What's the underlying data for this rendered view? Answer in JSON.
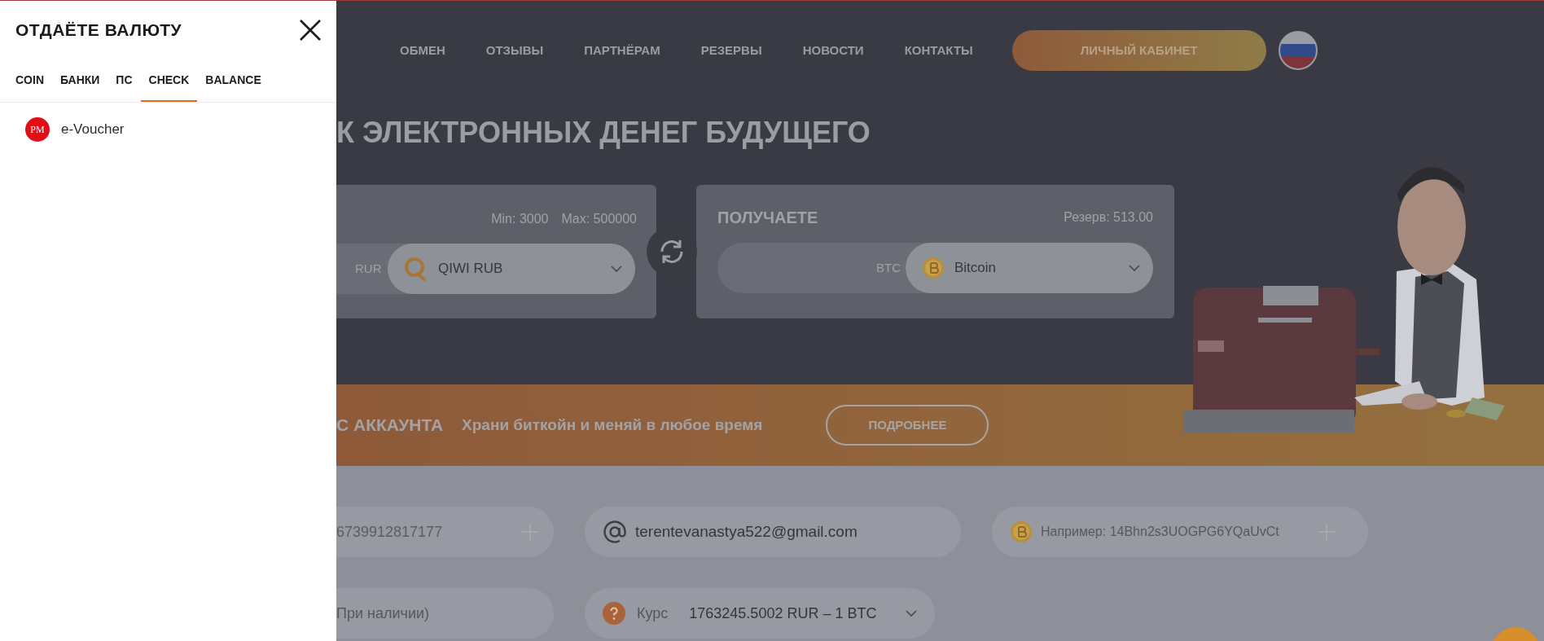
{
  "drawer": {
    "title": "ОТДАЁТЕ ВАЛЮТУ",
    "tabs": [
      {
        "label": "COIN",
        "selected": false
      },
      {
        "label": "БАНКИ",
        "selected": false
      },
      {
        "label": "ПС",
        "selected": false
      },
      {
        "label": "CHECK",
        "selected": true
      },
      {
        "label": "BALANCE",
        "selected": false
      }
    ],
    "items": [
      {
        "icon_text": "PM",
        "label": "e-Voucher"
      }
    ]
  },
  "nav": {
    "links": [
      "ОБМЕН",
      "ОТЗЫВЫ",
      "ПАРТНЁРАМ",
      "РЕЗЕРВЫ",
      "НОВОСТИ",
      "КОНТАКТЫ"
    ],
    "cabinet_button": "ЛИЧНЫЙ КАБИНЕТ"
  },
  "hero": {
    "headline": "К ЭЛЕКТРОННЫХ ДЕНЕГ БУДУЩЕГО",
    "give": {
      "min": "Min: 3000",
      "max": "Max: 500000",
      "currency_code": "RUR",
      "currency": "QIWI RUB"
    },
    "get": {
      "title": "ПОЛУЧАЕТЕ",
      "reserve": "Резерв: 513.00",
      "currency_code": "BTC",
      "currency": "Bitcoin"
    }
  },
  "promo": {
    "title": "С АККАУНТА",
    "text": "Храни биткойн и меняй в любое время",
    "button": "ПОДРОБНЕЕ"
  },
  "form": {
    "phone_value": "6739912817177",
    "email_value": "terentevanastya522@gmail.com",
    "wallet_placeholder": "Например: 14Bhn2s3UOGPG6YQaUvCt",
    "note_placeholder": "При наличии)",
    "rate_label": "Курс",
    "rate_value": "1763245.5002 RUR – 1 BTC"
  }
}
